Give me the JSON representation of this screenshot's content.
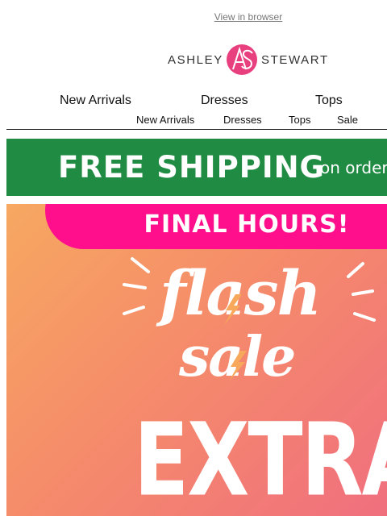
{
  "header": {
    "view_in_browser": "View in browser"
  },
  "logo": {
    "left": "ASHLEY",
    "right": "STEWART",
    "monogram": "AS",
    "accent": "#e8407f"
  },
  "nav_main": {
    "items": [
      "New Arrivals",
      "Dresses",
      "Tops"
    ]
  },
  "nav_sub": {
    "items": [
      "New Arrivals",
      "Dresses",
      "Tops",
      "Sale"
    ]
  },
  "shipping_banner": {
    "headline": "FREE SHIPPING",
    "tail": "on orders",
    "color": "#1f8b43"
  },
  "hero": {
    "badge": "FINAL HOURS!",
    "flash": "flash",
    "sale": "sale",
    "extra": "EXTRA",
    "badge_color": "#ff0f8b",
    "bolt_color": "#f7a85a"
  }
}
